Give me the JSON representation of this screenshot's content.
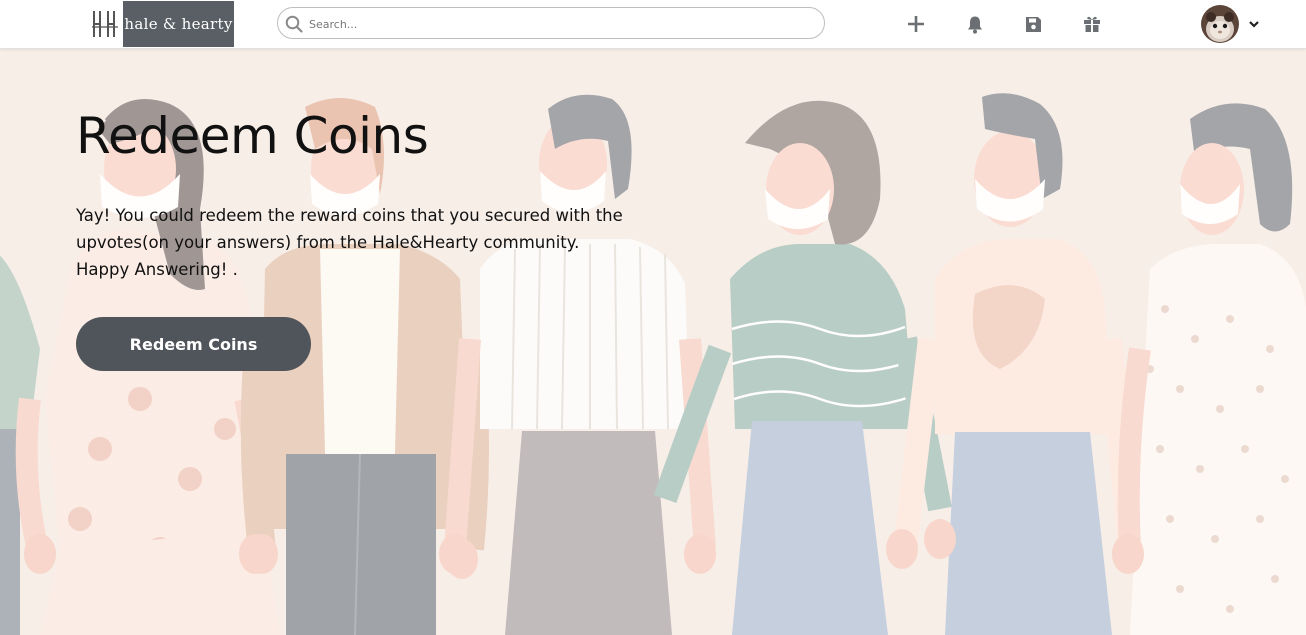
{
  "brand": {
    "name": "hale & hearty",
    "icon": "hh-monogram-icon"
  },
  "search": {
    "placeholder": "Search...",
    "value": "",
    "icon": "search-icon"
  },
  "nav": {
    "icons": [
      "plus-icon",
      "bell-icon",
      "save-icon",
      "gift-icon"
    ],
    "user_menu_icon": "chevron-down-icon"
  },
  "hero": {
    "title": "Redeem Coins",
    "description_lines": [
      "Yay! You could redeem the reward coins that you secured with the",
      "upvotes(on your answers) from the Hale&Hearty community.",
      "Happy Answering! ."
    ],
    "button_label": "Redeem Coins"
  },
  "colors": {
    "navbar_bg": "#ffffff",
    "logo_bg": "#5a5f65",
    "hero_bg": "#f6ece6",
    "button_bg": "#50555b",
    "button_text": "#ffffff",
    "icon_gray": "#6b6f73"
  }
}
